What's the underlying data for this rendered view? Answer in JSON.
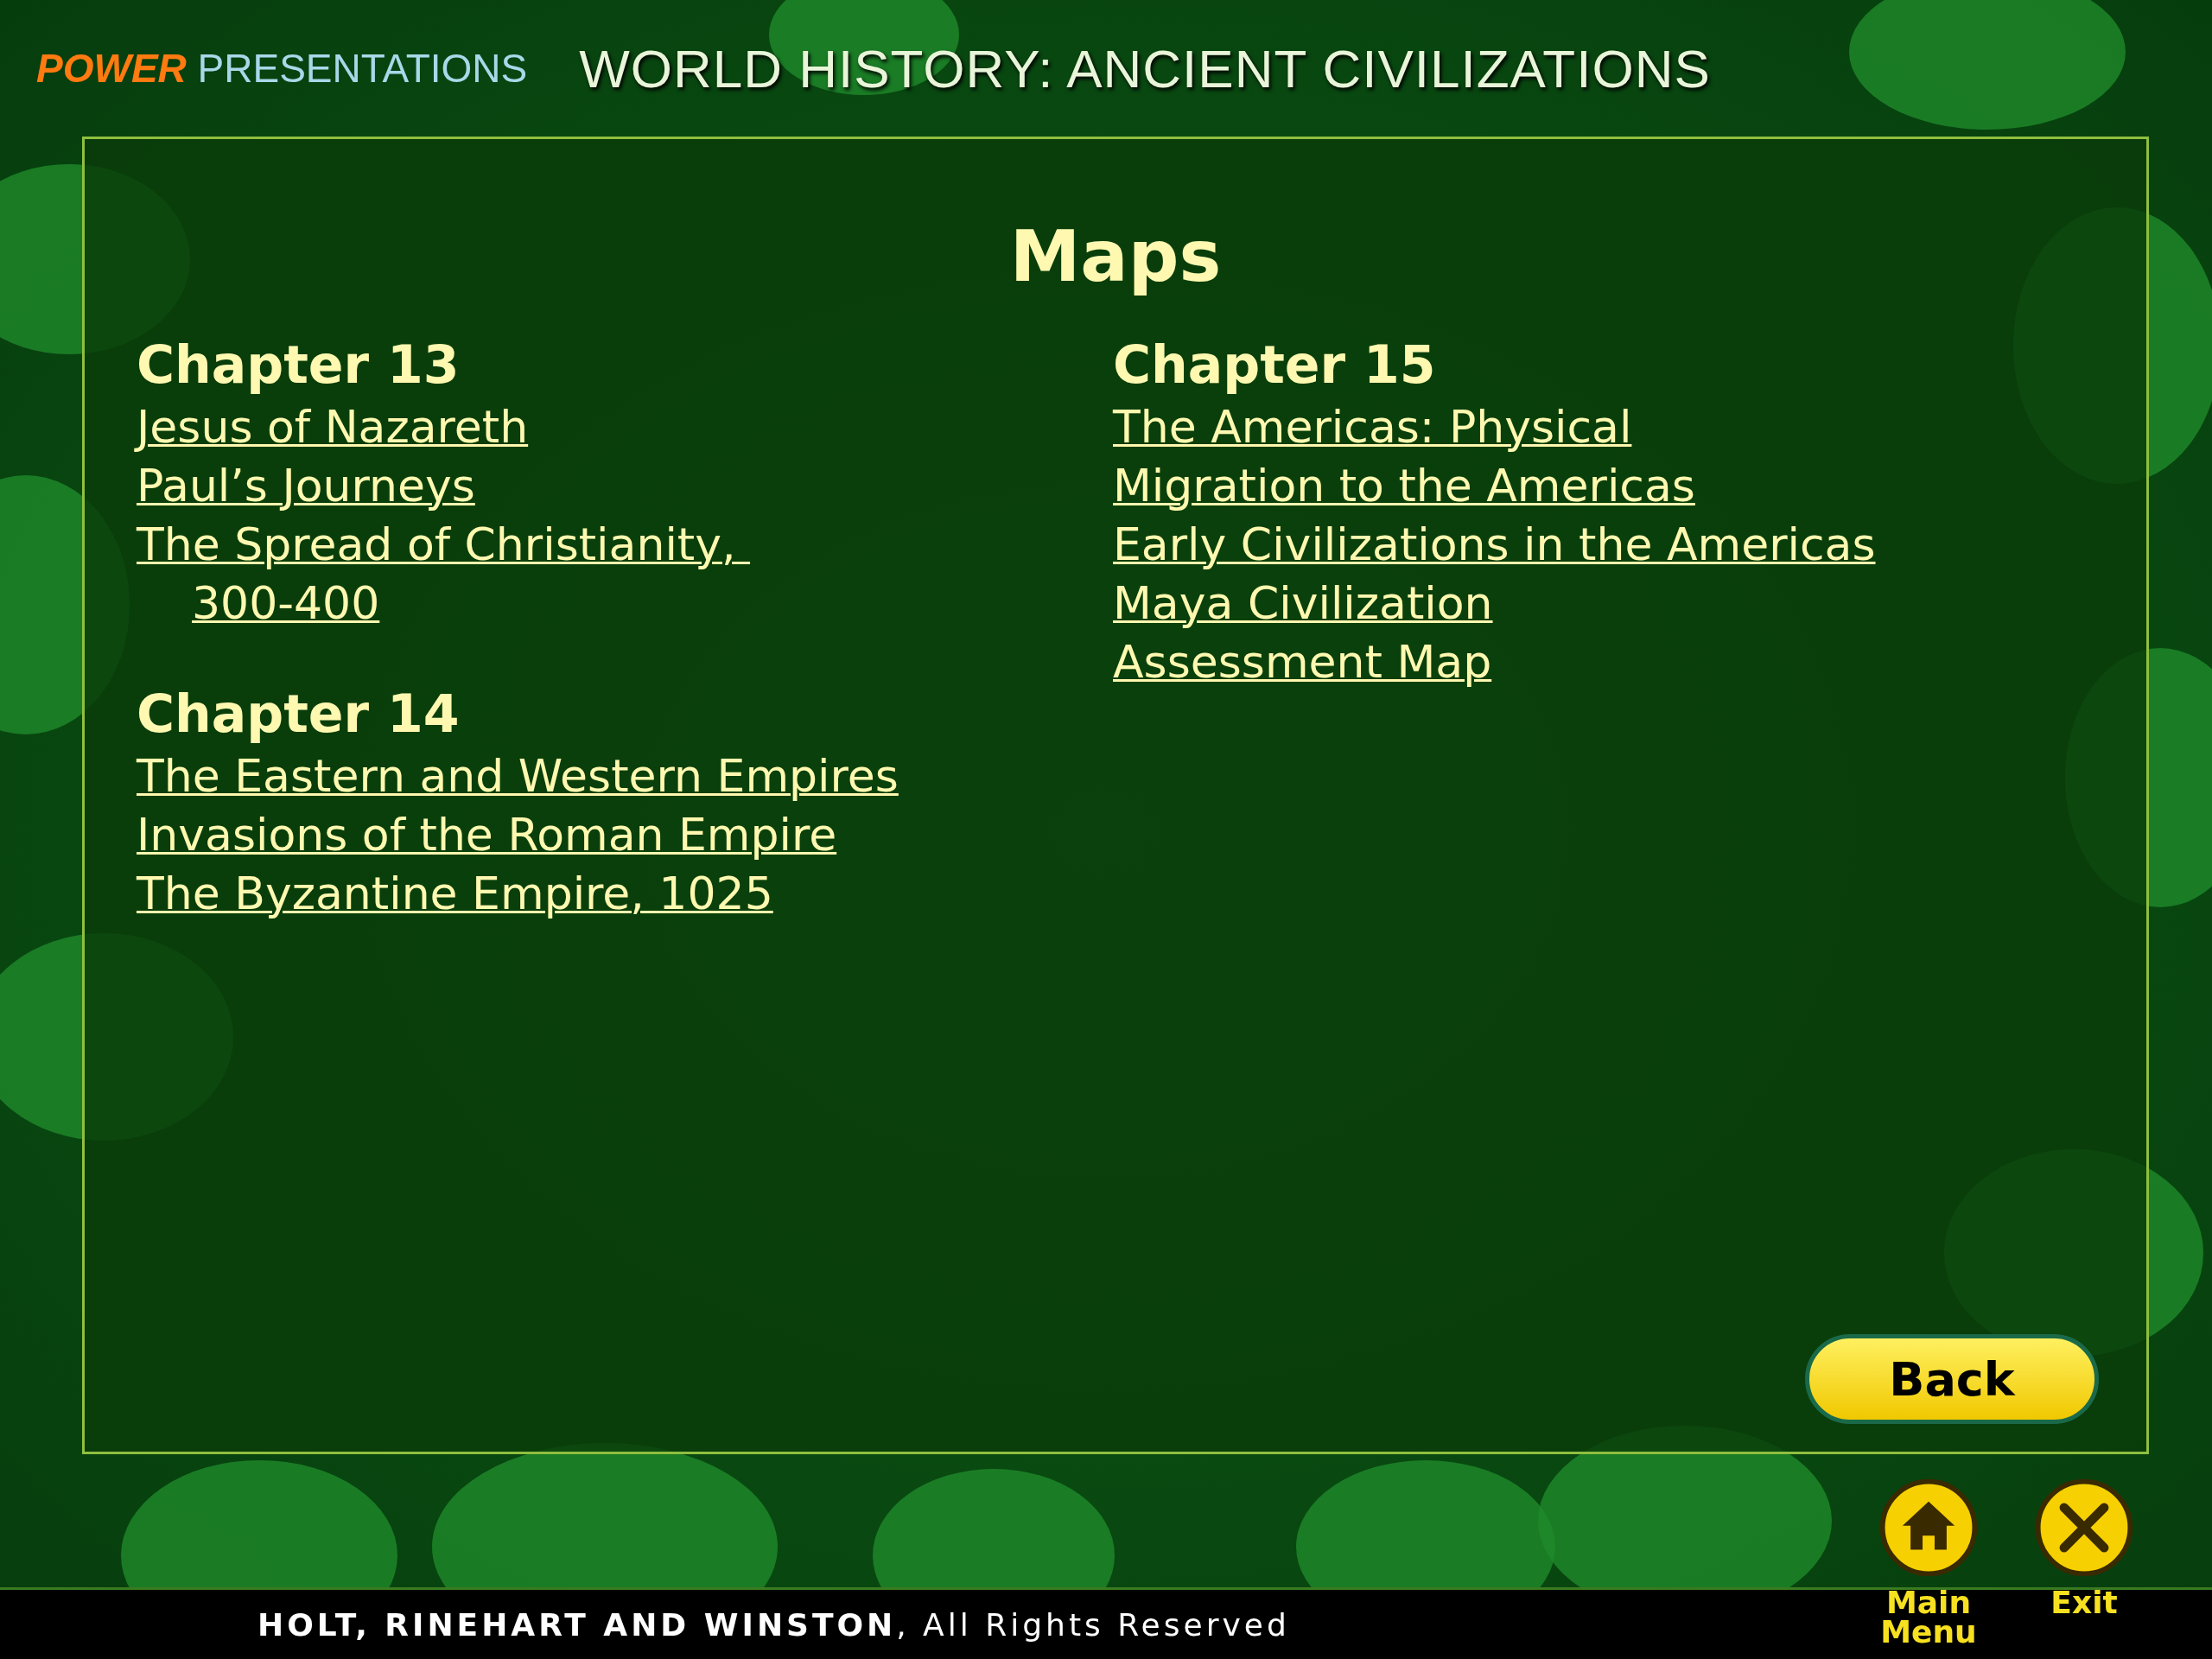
{
  "header": {
    "brand_bold": "POWER",
    "brand_rest": "PRESENTATIONS",
    "title": "WORLD HISTORY: ANCIENT CIVILIZATIONS"
  },
  "page_title": "Maps",
  "columns": [
    {
      "sections": [
        {
          "heading": "Chapter 13",
          "links": [
            "Jesus of Nazareth",
            "Paul’s Journeys",
            "The Spread of Christianity, \n300-400"
          ]
        },
        {
          "heading": "Chapter 14",
          "links": [
            "The Eastern and Western Empires",
            "Invasions of the Roman Empire",
            "The Byzantine Empire, 1025"
          ]
        }
      ]
    },
    {
      "sections": [
        {
          "heading": "Chapter 15",
          "links": [
            "The Americas: Physical",
            "Migration to the Americas",
            "Early Civilizations in the Americas",
            "Maya Civilization",
            "Assessment Map"
          ]
        }
      ]
    }
  ],
  "back_button": "Back",
  "nav": [
    {
      "kind": "home",
      "label": "Main\nMenu"
    },
    {
      "kind": "exit",
      "label": "Exit"
    }
  ],
  "footer": "**HOLT, RINEHART AND WINSTON**, All Rights Reserved"
}
